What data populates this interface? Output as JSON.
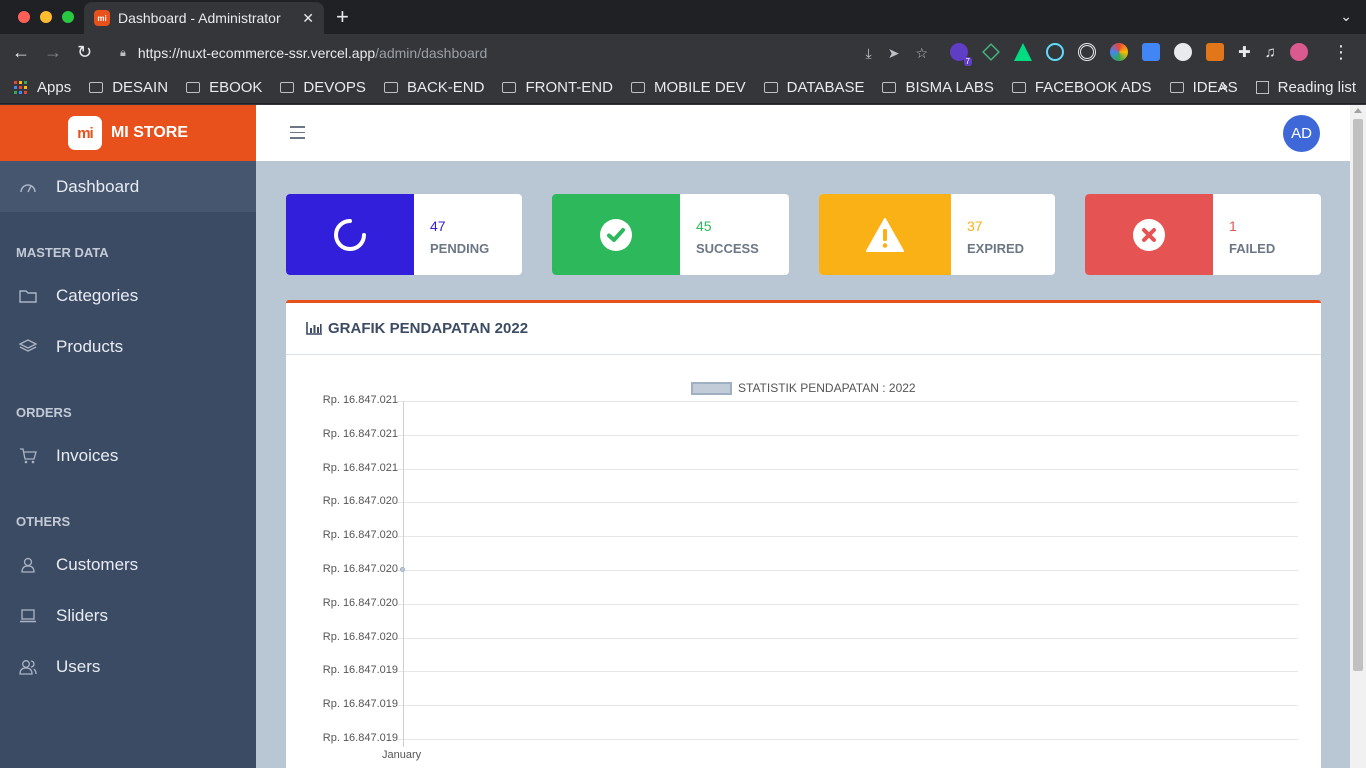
{
  "browser": {
    "tab_title": "Dashboard - Administrator",
    "url_host": "https://nuxt-ecommerce-ssr.vercel.app",
    "url_path": "/admin/dashboard",
    "extension_badge": "7",
    "bookmarks": [
      "Apps",
      "DESAIN",
      "EBOOK",
      "DEVOPS",
      "BACK-END",
      "FRONT-END",
      "MOBILE DEV",
      "DATABASE",
      "BISMA LABS",
      "FACEBOOK ADS",
      "IDEAS"
    ],
    "more_label": "»",
    "reading_list": "Reading list"
  },
  "brand": {
    "logo": "mi",
    "name": "MI STORE"
  },
  "sidebar": {
    "dashboard": "Dashboard",
    "sections": {
      "master": "MASTER DATA",
      "orders": "ORDERS",
      "others": "OTHERS"
    },
    "items": {
      "categories": "Categories",
      "products": "Products",
      "invoices": "Invoices",
      "customers": "Customers",
      "sliders": "Sliders",
      "users": "Users"
    }
  },
  "topbar": {
    "avatar": "AD"
  },
  "stats": [
    {
      "value": "47",
      "label": "PENDING",
      "color": "#321fdb",
      "icon": "spinner-icon"
    },
    {
      "value": "45",
      "label": "SUCCESS",
      "color": "#2eb85c",
      "icon": "check-circle-icon"
    },
    {
      "value": "37",
      "label": "EXPIRED",
      "color": "#f9b115",
      "icon": "warning-icon"
    },
    {
      "value": "1",
      "label": "FAILED",
      "color": "#e55353",
      "icon": "times-circle-icon"
    }
  ],
  "card": {
    "title": "GRAFIK PENDAPATAN 2022",
    "accent": "#e8501c"
  },
  "chart_data": {
    "type": "line",
    "legend": "STATISTIK PENDAPATAN : 2022",
    "categories": [
      "January"
    ],
    "series": [
      {
        "name": "STATISTIK PENDAPATAN : 2022",
        "values": [
          16847020
        ]
      }
    ],
    "y_tick_labels": [
      "Rp. 16.847.021",
      "Rp. 16.847.021",
      "Rp. 16.847.021",
      "Rp. 16.847.020",
      "Rp. 16.847.020",
      "Rp. 16.847.020",
      "Rp. 16.847.020",
      "Rp. 16.847.020",
      "Rp. 16.847.019",
      "Rp. 16.847.019",
      "Rp. 16.847.019"
    ],
    "ylim": [
      16847019,
      16847021
    ],
    "grid": true,
    "legend_position": "top-center"
  }
}
